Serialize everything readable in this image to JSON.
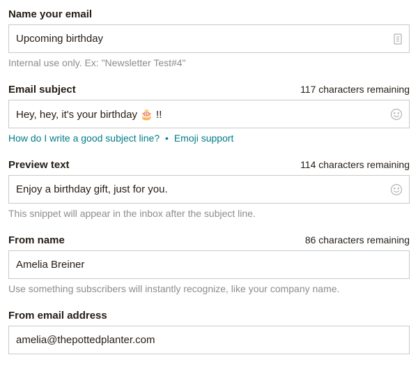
{
  "name_email": {
    "label": "Name your email",
    "value": "Upcoming birthday",
    "helper": "Internal use only. Ex: \"Newsletter Test#4\""
  },
  "subject": {
    "label": "Email subject",
    "remaining": "117 characters remaining",
    "value": "Hey, hey, it's your birthday 🎂 !!",
    "help_link": "How do I write a good subject line?",
    "emoji_link": "Emoji support"
  },
  "preview": {
    "label": "Preview text",
    "remaining": "114 characters remaining",
    "value": "Enjoy a birthday gift, just for you.",
    "helper": "This snippet will appear in the inbox after the subject line."
  },
  "from_name": {
    "label": "From name",
    "remaining": "86 characters remaining",
    "value": "Amelia Breiner",
    "helper": "Use something subscribers will instantly recognize, like your company name."
  },
  "from_email": {
    "label": "From email address",
    "value": "amelia@thepottedplanter.com"
  },
  "separator": "•"
}
